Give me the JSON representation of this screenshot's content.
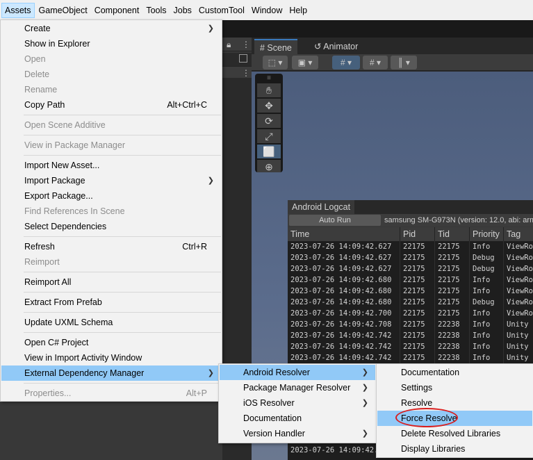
{
  "menubar": {
    "items": [
      "Assets",
      "GameObject",
      "Component",
      "Tools",
      "Jobs",
      "CustomTool",
      "Window",
      "Help"
    ]
  },
  "scene_tabs": {
    "scene": "# Scene",
    "animator": "Animator"
  },
  "logcat": {
    "title": "Android Logcat",
    "auto_run": "Auto Run",
    "device": "samsung SM-G973N (version: 12.0, abi: arm",
    "columns": [
      "Time",
      "Pid",
      "Tid",
      "Priority",
      "Tag"
    ],
    "rows": [
      {
        "time": "2023-07-26 14:09:42.627",
        "pid": "22175",
        "tid": "22175",
        "priority": "Info",
        "tag": "ViewRo"
      },
      {
        "time": "2023-07-26 14:09:42.627",
        "pid": "22175",
        "tid": "22175",
        "priority": "Debug",
        "tag": "ViewRo"
      },
      {
        "time": "2023-07-26 14:09:42.627",
        "pid": "22175",
        "tid": "22175",
        "priority": "Debug",
        "tag": "ViewRo"
      },
      {
        "time": "2023-07-26 14:09:42.680",
        "pid": "22175",
        "tid": "22175",
        "priority": "Info",
        "tag": "ViewRo"
      },
      {
        "time": "2023-07-26 14:09:42.680",
        "pid": "22175",
        "tid": "22175",
        "priority": "Info",
        "tag": "ViewRo"
      },
      {
        "time": "2023-07-26 14:09:42.680",
        "pid": "22175",
        "tid": "22175",
        "priority": "Debug",
        "tag": "ViewRo"
      },
      {
        "time": "2023-07-26 14:09:42.700",
        "pid": "22175",
        "tid": "22175",
        "priority": "Info",
        "tag": "ViewRo"
      },
      {
        "time": "2023-07-26 14:09:42.708",
        "pid": "22175",
        "tid": "22238",
        "priority": "Info",
        "tag": "Unity"
      },
      {
        "time": "2023-07-26 14:09:42.742",
        "pid": "22175",
        "tid": "22238",
        "priority": "Info",
        "tag": "Unity"
      },
      {
        "time": "2023-07-26 14:09:42.742",
        "pid": "22175",
        "tid": "22238",
        "priority": "Info",
        "tag": "Unity"
      },
      {
        "time": "2023-07-26 14:09:42.742",
        "pid": "22175",
        "tid": "22238",
        "priority": "Info",
        "tag": "Unity"
      }
    ],
    "bottom_partial": "2023-07-26 14:09:42."
  },
  "assets_menu": {
    "create": "Create",
    "show_in_explorer": "Show in Explorer",
    "open": "Open",
    "delete": "Delete",
    "rename": "Rename",
    "copy_path": "Copy Path",
    "copy_path_shortcut": "Alt+Ctrl+C",
    "open_scene_additive": "Open Scene Additive",
    "view_in_package_manager": "View in Package Manager",
    "import_new_asset": "Import New Asset...",
    "import_package": "Import Package",
    "export_package": "Export Package...",
    "find_references": "Find References In Scene",
    "select_dependencies": "Select Dependencies",
    "refresh": "Refresh",
    "refresh_shortcut": "Ctrl+R",
    "reimport": "Reimport",
    "reimport_all": "Reimport All",
    "extract_from_prefab": "Extract From Prefab",
    "update_uxml_schema": "Update UXML Schema",
    "open_csharp_project": "Open C# Project",
    "view_in_import_activity": "View in Import Activity Window",
    "external_dependency_manager": "External Dependency Manager",
    "properties": "Properties...",
    "properties_shortcut": "Alt+P"
  },
  "edm_menu": {
    "android_resolver": "Android Resolver",
    "package_manager_resolver": "Package Manager Resolver",
    "ios_resolver": "iOS Resolver",
    "documentation": "Documentation",
    "version_handler": "Version Handler"
  },
  "android_resolver_menu": {
    "documentation": "Documentation",
    "settings": "Settings",
    "resolve": "Resolve",
    "force_resolve": "Force Resolve",
    "delete_resolved_libraries": "Delete Resolved Libraries",
    "display_libraries": "Display Libraries"
  },
  "colors": {
    "highlight": "#91c9f7",
    "annotation_circle": "#d81e1e",
    "menu_background": "#f2f2f2"
  }
}
